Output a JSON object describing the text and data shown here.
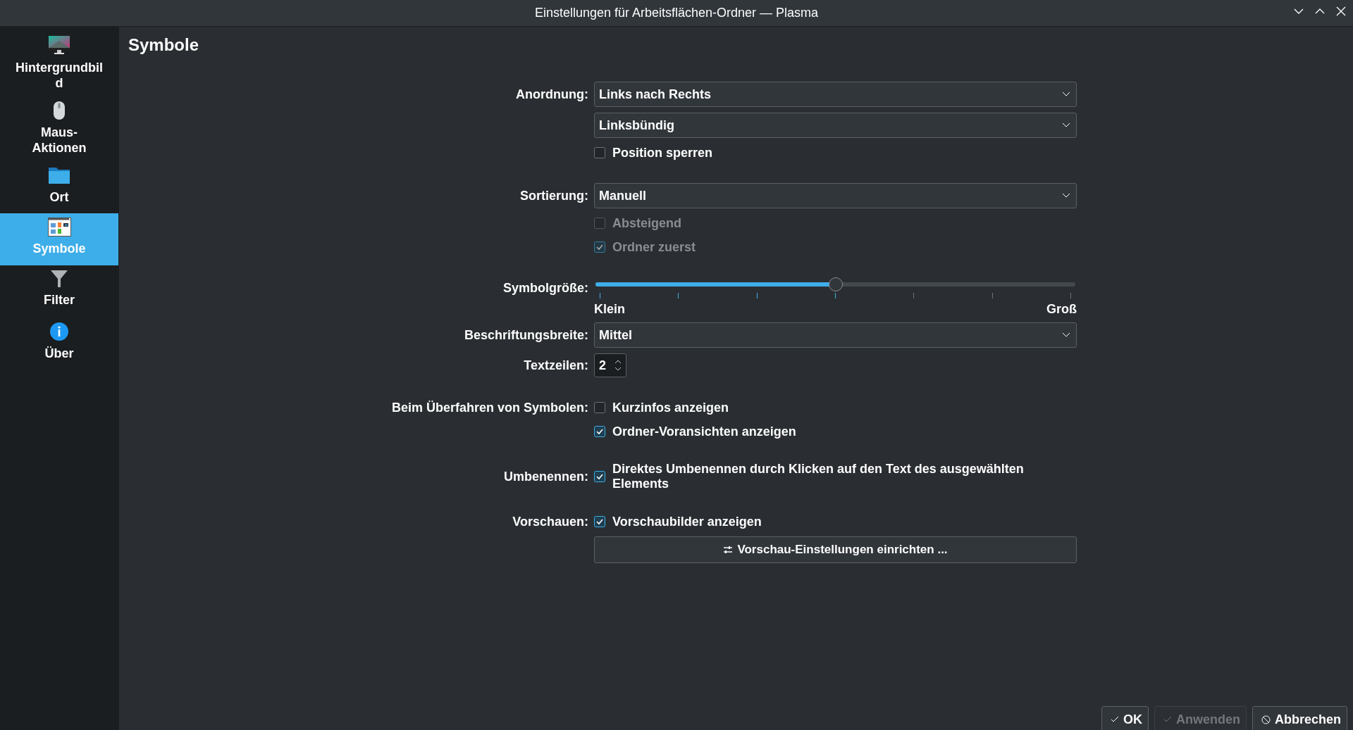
{
  "window": {
    "title": "Einstellungen für Arbeitsflächen-Ordner — Plasma"
  },
  "sidebar": {
    "items": [
      {
        "label": "Hintergrundbild",
        "selected": false
      },
      {
        "label": "Maus-Aktionen",
        "selected": false
      },
      {
        "label": "Ort",
        "selected": false
      },
      {
        "label": "Symbole",
        "selected": true
      },
      {
        "label": "Filter",
        "selected": false
      },
      {
        "label": "Über",
        "selected": false
      }
    ]
  },
  "page": {
    "title": "Symbole"
  },
  "sections": [
    {
      "rows": [
        {
          "kind": "combo",
          "label": "Anordnung:",
          "value": "Links nach Rechts"
        },
        {
          "kind": "combo",
          "value": "Linksbündig"
        },
        {
          "kind": "checkbox",
          "text": "Position sperren",
          "checked": false,
          "disabled": false
        }
      ]
    },
    {
      "rows": [
        {
          "kind": "combo",
          "label": "Sortierung:",
          "value": "Manuell"
        },
        {
          "kind": "checkbox",
          "text": "Absteigend",
          "checked": false,
          "disabled": true
        },
        {
          "kind": "checkbox",
          "text": "Ordner zuerst",
          "checked": true,
          "disabled": true
        }
      ]
    },
    {
      "rows": [
        {
          "kind": "slider",
          "label": "Symbolgröße:",
          "level": 0.5,
          "min_label": "Klein",
          "max_label": "Groß"
        },
        {
          "kind": "combo",
          "label": "Beschriftungsbreite:",
          "value": "Mittel"
        },
        {
          "kind": "spin",
          "label": "Textzeilen:",
          "value": "2"
        }
      ]
    },
    {
      "rows": [
        {
          "kind": "checkbox",
          "label": "Beim Überfahren von Symbolen:",
          "text": "Kurzinfos anzeigen",
          "checked": false,
          "disabled": false
        },
        {
          "kind": "checkbox",
          "text": "Ordner-Voransichten anzeigen",
          "checked": true,
          "disabled": false
        }
      ]
    },
    {
      "rows": [
        {
          "kind": "checkbox",
          "label": "Umbenennen:",
          "text": "Direktes Umbenennen durch Klicken auf den Text des ausgewählten Elements",
          "checked": true,
          "disabled": false
        }
      ]
    },
    {
      "rows": [
        {
          "kind": "checkbox",
          "label": "Vorschauen:",
          "text": "Vorschaubilder anzeigen",
          "checked": true,
          "disabled": false
        },
        {
          "kind": "button",
          "text": "Vorschau-Einstellungen einrichten ..."
        }
      ]
    }
  ],
  "buttons": [
    {
      "text": "OK",
      "disabled": false
    },
    {
      "text": "Anwenden",
      "disabled": true
    },
    {
      "text": "Abbrechen",
      "disabled": false
    }
  ]
}
